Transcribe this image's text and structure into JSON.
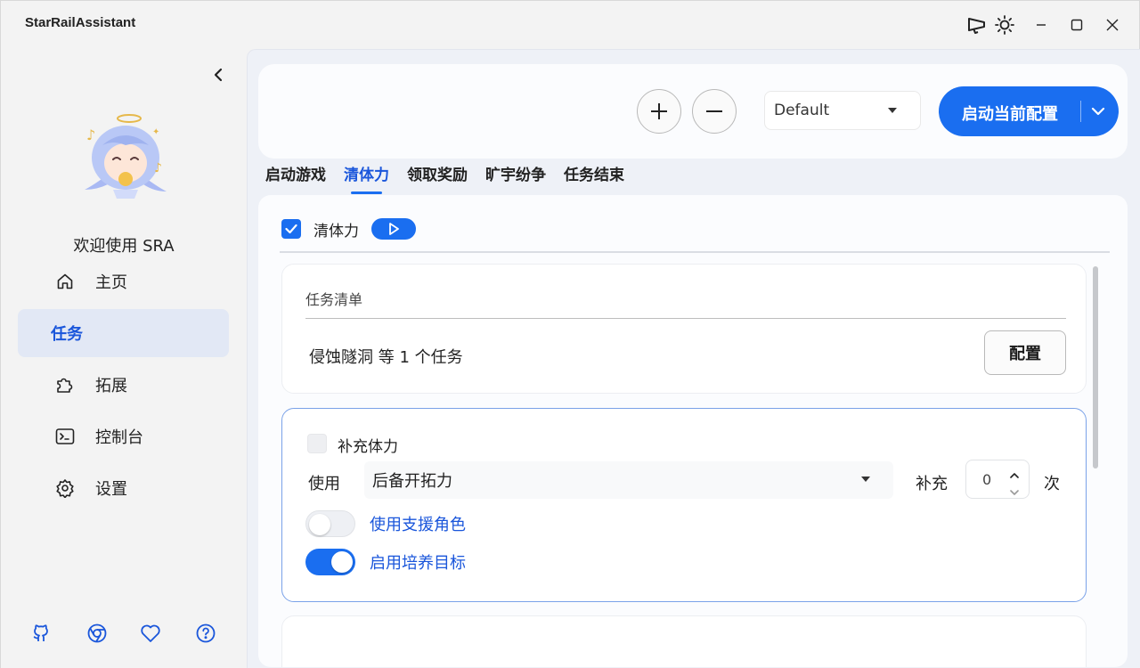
{
  "window": {
    "title": "StarRailAssistant"
  },
  "sidebar": {
    "welcome": "欢迎使用 SRA",
    "items": [
      {
        "label": "主页",
        "icon": "home-icon"
      },
      {
        "label": "任务",
        "icon": "",
        "active": true
      },
      {
        "label": "拓展",
        "icon": "puzzle-icon"
      },
      {
        "label": "控制台",
        "icon": "terminal-icon"
      },
      {
        "label": "设置",
        "icon": "gear-icon"
      }
    ],
    "footer_icons": [
      "github-icon",
      "chrome-icon",
      "heart-icon",
      "help-icon"
    ]
  },
  "toolbar": {
    "profile_value": "Default",
    "start_label": "启动当前配置"
  },
  "tabs": [
    "启动游戏",
    "清体力",
    "领取奖励",
    "旷宇纷争",
    "任务结束"
  ],
  "active_tab": 1,
  "panel": {
    "head_label": "清体力",
    "task_list": {
      "title": "任务清单",
      "summary": "侵蚀隧洞 等 1 个任务",
      "config_label": "配置"
    },
    "refill": {
      "checkbox_label": "补充体力",
      "use_label": "使用",
      "use_value": "后备开拓力",
      "refill_label": "补充",
      "count": "0",
      "times_label": "次",
      "support_toggle_label": "使用支援角色",
      "support_on": false,
      "training_toggle_label": "启用培养目标",
      "training_on": true
    }
  },
  "colors": {
    "accent": "#1a6ef0",
    "active_nav_bg": "#e2e8f5"
  }
}
